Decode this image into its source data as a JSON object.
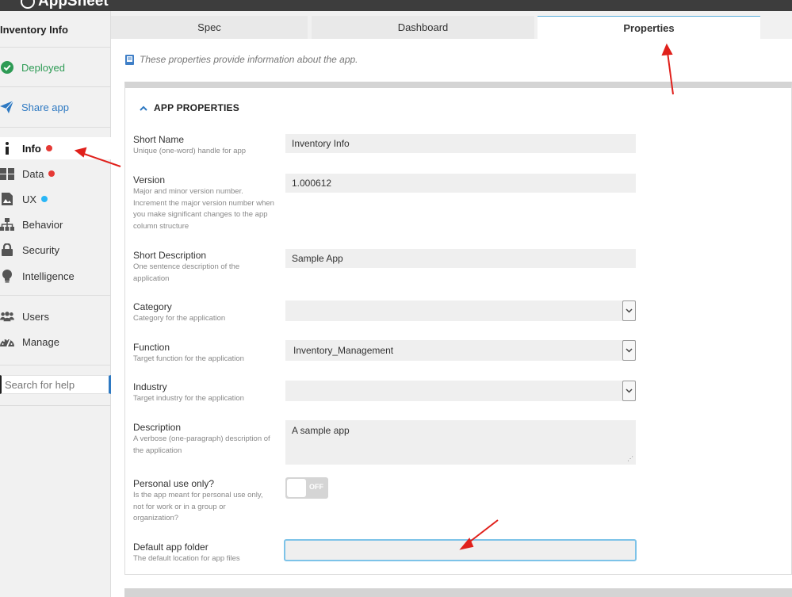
{
  "brand": "AppSheet",
  "app_title": "Inventory Info",
  "sidebar": {
    "deployed": "Deployed",
    "share": "Share app",
    "items": [
      {
        "label": "Info"
      },
      {
        "label": "Data"
      },
      {
        "label": "UX"
      },
      {
        "label": "Behavior"
      },
      {
        "label": "Security"
      },
      {
        "label": "Intelligence"
      }
    ],
    "users": "Users",
    "manage": "Manage",
    "search_placeholder": "Search for help"
  },
  "tabs": [
    "Spec",
    "Dashboard",
    "Properties"
  ],
  "info_text": "These properties provide information about the app.",
  "section_title": "APP PROPERTIES",
  "fields": {
    "short_name": {
      "label": "Short Name",
      "desc": "Unique (one-word) handle for app",
      "value": "Inventory Info"
    },
    "version": {
      "label": "Version",
      "desc": "Major and minor version number. Increment the major version number when you make significant changes to the app column structure",
      "value": "1.000612"
    },
    "short_description": {
      "label": "Short Description",
      "desc": "One sentence description of the application",
      "value": "Sample App"
    },
    "category": {
      "label": "Category",
      "desc": "Category for the application",
      "value": ""
    },
    "function": {
      "label": "Function",
      "desc": "Target function for the application",
      "value": "Inventory_Management"
    },
    "industry": {
      "label": "Industry",
      "desc": "Target industry for the application",
      "value": ""
    },
    "description": {
      "label": "Description",
      "desc": "A verbose (one-paragraph) description of the application",
      "value": "A sample app"
    },
    "personal_use": {
      "label": "Personal use only?",
      "desc": "Is the app meant for personal use only, not for work or in a group or organization?",
      "toggle": "OFF"
    },
    "default_folder": {
      "label": "Default app folder",
      "desc": "The default location for app files",
      "value": ""
    }
  },
  "colors": {
    "accent": "#2e79c2",
    "success": "#2e9b55",
    "annotation": "#e0201b"
  }
}
